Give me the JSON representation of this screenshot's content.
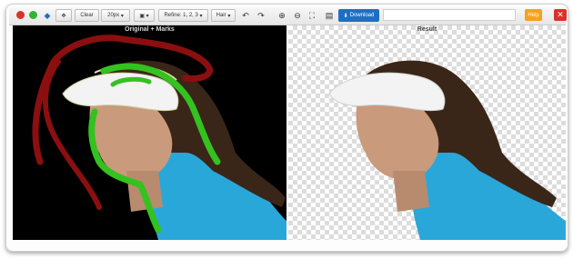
{
  "toolbar": {
    "clear_label": "Clear",
    "brush_size": "20px",
    "refine_label": "Refine: 1, 2, 3",
    "hair_label": "Hair",
    "download_label": "Download",
    "help_label": "Help"
  },
  "panels": {
    "left_title": "Original + Marks",
    "right_title": "Result"
  },
  "colors": {
    "remove_mark": "#8b0f0f",
    "keep_mark": "#33c21f",
    "download_button": "#1f6fc1",
    "help_button": "#f4a21d",
    "close_button": "#d9322b"
  }
}
